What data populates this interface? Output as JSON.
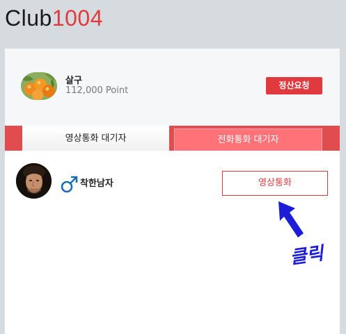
{
  "logo": {
    "brand": "Club",
    "number": "1004"
  },
  "profile": {
    "name": "살구",
    "points": "112,000 Point",
    "settle_button": "정산요청"
  },
  "tabs": {
    "video_waiting": "영상통화 대기자",
    "phone_waiting": "전화통화 대기자"
  },
  "user": {
    "gender_icon": "male-icon",
    "name": "착한남자",
    "call_button": "영상통화"
  },
  "annotation": {
    "click_text": "클릭"
  },
  "colors": {
    "accent": "#e0393e",
    "tab_bar": "#e14d4f",
    "inactive_tab": "#ff7277",
    "annotation": "#1d1dd8",
    "male_icon": "#1a6fb4"
  }
}
